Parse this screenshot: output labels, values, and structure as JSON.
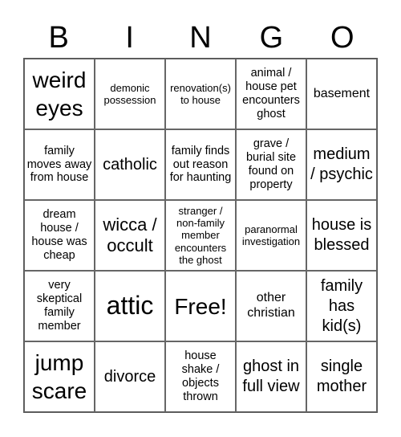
{
  "header": [
    "B",
    "I",
    "N",
    "G",
    "O"
  ],
  "cells": [
    "weird eyes",
    "demonic possession",
    "renovation(s) to house",
    "animal / house pet encounters ghost",
    "basement",
    "family moves away from house",
    "catholic",
    "family finds out reason for haunting",
    "grave / burial site found on property",
    "medium / psychic",
    "dream house / house was cheap",
    "wicca / occult",
    "stranger / non-family member encounters the ghost",
    "paranormal investigation",
    "house is blessed",
    "very skeptical family member",
    "attic",
    "Free!",
    "other christian",
    "family has kid(s)",
    "jump scare",
    "divorce",
    "house shake / objects thrown",
    "ghost in full view",
    "single mother"
  ]
}
